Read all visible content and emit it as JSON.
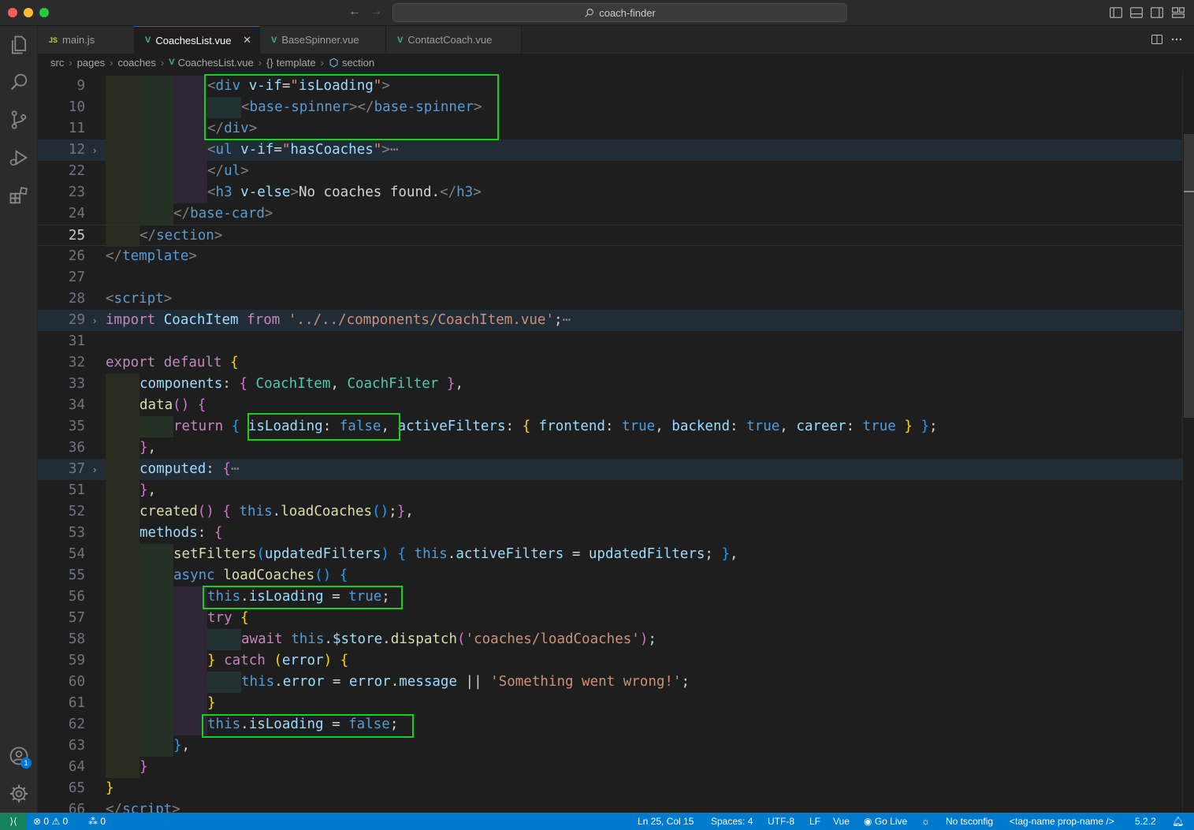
{
  "window": {
    "title": "coach-finder"
  },
  "tabs": [
    {
      "icon": "JS",
      "label": "main.js",
      "active": false
    },
    {
      "icon": "V",
      "label": "CoachesList.vue",
      "active": true,
      "close": "✕"
    },
    {
      "icon": "V",
      "label": "BaseSpinner.vue",
      "active": false
    },
    {
      "icon": "V",
      "label": "ContactCoach.vue",
      "active": false
    }
  ],
  "breadcrumb": {
    "items": [
      "src",
      "pages",
      "coaches",
      "CoachesList.vue",
      "template",
      "section"
    ],
    "template_icon": "{}",
    "vue_icon": "V"
  },
  "editor": {
    "line_numbers": [
      "9",
      "10",
      "11",
      "12",
      "22",
      "23",
      "24",
      "25",
      "26",
      "27",
      "28",
      "29",
      "31",
      "32",
      "33",
      "34",
      "35",
      "36",
      "37",
      "51",
      "52",
      "53",
      "54",
      "55",
      "56",
      "57",
      "58",
      "59",
      "60",
      "61",
      "62",
      "63",
      "64",
      "65",
      "66"
    ],
    "current_line": "25",
    "lines": [
      [
        [
          "t-br",
          "<"
        ],
        [
          "t-tag",
          "div"
        ],
        [
          "t-txt",
          " "
        ],
        [
          "t-attr",
          "v-if"
        ],
        [
          "t-txt",
          "="
        ],
        [
          "t-strq",
          "\""
        ],
        [
          "t-attr",
          "isLoading"
        ],
        [
          "t-strq",
          "\""
        ],
        [
          "t-br",
          ">"
        ]
      ],
      [
        [
          "t-br",
          "<"
        ],
        [
          "t-tag",
          "base-spinner"
        ],
        [
          "t-br",
          "></"
        ],
        [
          "t-tag",
          "base-spinner"
        ],
        [
          "t-br",
          ">"
        ]
      ],
      [
        [
          "t-br",
          "</"
        ],
        [
          "t-tag",
          "div"
        ],
        [
          "t-br",
          ">"
        ]
      ],
      [
        [
          "t-br",
          "<"
        ],
        [
          "t-tag",
          "ul"
        ],
        [
          "t-txt",
          " "
        ],
        [
          "t-attr",
          "v-if"
        ],
        [
          "t-txt",
          "="
        ],
        [
          "t-strq",
          "\""
        ],
        [
          "t-attr",
          "hasCoaches"
        ],
        [
          "t-strq",
          "\""
        ],
        [
          "t-br",
          ">"
        ],
        [
          "t-ell",
          "⋯"
        ]
      ],
      [
        [
          "t-br",
          "</"
        ],
        [
          "t-tag",
          "ul"
        ],
        [
          "t-br",
          ">"
        ]
      ],
      [
        [
          "t-br",
          "<"
        ],
        [
          "t-tag",
          "h3"
        ],
        [
          "t-txt",
          " "
        ],
        [
          "t-attr",
          "v-else"
        ],
        [
          "t-br",
          ">"
        ],
        [
          "t-txt",
          "No coaches found."
        ],
        [
          "t-br",
          "</"
        ],
        [
          "t-tag",
          "h3"
        ],
        [
          "t-br",
          ">"
        ]
      ],
      [
        [
          "t-br",
          "</"
        ],
        [
          "t-tag",
          "base-card"
        ],
        [
          "t-br",
          ">"
        ]
      ],
      [
        [
          "t-br",
          "</"
        ],
        [
          "t-tag",
          "section"
        ],
        [
          "t-br",
          ">"
        ]
      ],
      [
        [
          "t-br",
          "</"
        ],
        [
          "t-tag",
          "template"
        ],
        [
          "t-br",
          ">"
        ]
      ],
      [],
      [
        [
          "t-br",
          "<"
        ],
        [
          "t-tag",
          "script"
        ],
        [
          "t-br",
          ">"
        ]
      ],
      [
        [
          "t-kw",
          "import"
        ],
        [
          "t-txt",
          " "
        ],
        [
          "t-prop",
          "CoachItem"
        ],
        [
          "t-txt",
          " "
        ],
        [
          "t-kw",
          "from"
        ],
        [
          "t-txt",
          " "
        ],
        [
          "t-str",
          "'../../components/CoachItem.vue'"
        ],
        [
          "t-txt",
          ";"
        ],
        [
          "t-ell",
          "⋯"
        ]
      ],
      [],
      [
        [
          "t-kw",
          "export"
        ],
        [
          "t-txt",
          " "
        ],
        [
          "t-kw",
          "default"
        ],
        [
          "t-txt",
          " "
        ],
        [
          "t-b1",
          "{"
        ]
      ],
      [
        [
          "t-prop",
          "components"
        ],
        [
          "t-txt",
          ": "
        ],
        [
          "t-b2",
          "{"
        ],
        [
          "t-txt",
          " "
        ],
        [
          "t-cls",
          "CoachItem"
        ],
        [
          "t-txt",
          ", "
        ],
        [
          "t-cls",
          "CoachFilter"
        ],
        [
          "t-txt",
          " "
        ],
        [
          "t-b2",
          "}"
        ],
        [
          "t-txt",
          ","
        ]
      ],
      [
        [
          "t-fn",
          "data"
        ],
        [
          "t-b2",
          "()"
        ],
        [
          "t-txt",
          " "
        ],
        [
          "t-b2",
          "{"
        ]
      ],
      [
        [
          "t-kw",
          "return"
        ],
        [
          "t-txt",
          " "
        ],
        [
          "t-b3",
          "{"
        ],
        [
          "t-txt",
          " "
        ],
        [
          "t-prop",
          "isLoading"
        ],
        [
          "t-txt",
          ": "
        ],
        [
          "t-kw2",
          "false"
        ],
        [
          "t-txt",
          ", "
        ],
        [
          "t-prop",
          "activeFilters"
        ],
        [
          "t-txt",
          ": "
        ],
        [
          "t-b1",
          "{"
        ],
        [
          "t-txt",
          " "
        ],
        [
          "t-prop",
          "frontend"
        ],
        [
          "t-txt",
          ": "
        ],
        [
          "t-kw2",
          "true"
        ],
        [
          "t-txt",
          ", "
        ],
        [
          "t-prop",
          "backend"
        ],
        [
          "t-txt",
          ": "
        ],
        [
          "t-kw2",
          "true"
        ],
        [
          "t-txt",
          ", "
        ],
        [
          "t-prop",
          "career"
        ],
        [
          "t-txt",
          ": "
        ],
        [
          "t-kw2",
          "true"
        ],
        [
          "t-txt",
          " "
        ],
        [
          "t-b1",
          "}"
        ],
        [
          "t-txt",
          " "
        ],
        [
          "t-b3",
          "}"
        ],
        [
          "t-txt",
          ";"
        ]
      ],
      [
        [
          "t-b2",
          "}"
        ],
        [
          "t-txt",
          ","
        ]
      ],
      [
        [
          "t-prop",
          "computed"
        ],
        [
          "t-txt",
          ": "
        ],
        [
          "t-b2",
          "{"
        ],
        [
          "t-ell",
          "⋯"
        ]
      ],
      [
        [
          "t-b2",
          "}"
        ],
        [
          "t-txt",
          ","
        ]
      ],
      [
        [
          "t-fn",
          "created"
        ],
        [
          "t-b2",
          "()"
        ],
        [
          "t-txt",
          " "
        ],
        [
          "t-b2",
          "{"
        ],
        [
          "t-txt",
          " "
        ],
        [
          "t-kw2",
          "this"
        ],
        [
          "t-txt",
          "."
        ],
        [
          "t-fn",
          "loadCoaches"
        ],
        [
          "t-b3",
          "()"
        ],
        [
          "t-txt",
          ";"
        ],
        [
          "t-b2",
          "}"
        ],
        [
          "t-txt",
          ","
        ]
      ],
      [
        [
          "t-prop",
          "methods"
        ],
        [
          "t-txt",
          ": "
        ],
        [
          "t-b2",
          "{"
        ]
      ],
      [
        [
          "t-fn",
          "setFilters"
        ],
        [
          "t-b3",
          "("
        ],
        [
          "t-prop",
          "updatedFilters"
        ],
        [
          "t-b3",
          ")"
        ],
        [
          "t-txt",
          " "
        ],
        [
          "t-b3",
          "{"
        ],
        [
          "t-txt",
          " "
        ],
        [
          "t-kw2",
          "this"
        ],
        [
          "t-txt",
          "."
        ],
        [
          "t-prop",
          "activeFilters"
        ],
        [
          "t-txt",
          " = "
        ],
        [
          "t-prop",
          "updatedFilters"
        ],
        [
          "t-txt",
          "; "
        ],
        [
          "t-b3",
          "}"
        ],
        [
          "t-txt",
          ","
        ]
      ],
      [
        [
          "t-kw2",
          "async"
        ],
        [
          "t-txt",
          " "
        ],
        [
          "t-fn",
          "loadCoaches"
        ],
        [
          "t-b3",
          "()"
        ],
        [
          "t-txt",
          " "
        ],
        [
          "t-b3",
          "{"
        ]
      ],
      [
        [
          "t-kw2",
          "this"
        ],
        [
          "t-txt",
          "."
        ],
        [
          "t-prop",
          "isLoading"
        ],
        [
          "t-txt",
          " = "
        ],
        [
          "t-kw2",
          "true"
        ],
        [
          "t-txt",
          ";"
        ]
      ],
      [
        [
          "t-kw",
          "try"
        ],
        [
          "t-txt",
          " "
        ],
        [
          "t-b1",
          "{"
        ]
      ],
      [
        [
          "t-kw",
          "await"
        ],
        [
          "t-txt",
          " "
        ],
        [
          "t-kw2",
          "this"
        ],
        [
          "t-txt",
          "."
        ],
        [
          "t-prop",
          "$store"
        ],
        [
          "t-txt",
          "."
        ],
        [
          "t-fn",
          "dispatch"
        ],
        [
          "t-b2",
          "("
        ],
        [
          "t-str",
          "'coaches/loadCoaches'"
        ],
        [
          "t-b2",
          ")"
        ],
        [
          "t-txt",
          ";"
        ]
      ],
      [
        [
          "t-b1",
          "}"
        ],
        [
          "t-txt",
          " "
        ],
        [
          "t-kw",
          "catch"
        ],
        [
          "t-txt",
          " "
        ],
        [
          "t-b1",
          "("
        ],
        [
          "t-prop",
          "error"
        ],
        [
          "t-b1",
          ")"
        ],
        [
          "t-txt",
          " "
        ],
        [
          "t-b1",
          "{"
        ]
      ],
      [
        [
          "t-kw2",
          "this"
        ],
        [
          "t-txt",
          "."
        ],
        [
          "t-prop",
          "error"
        ],
        [
          "t-txt",
          " = "
        ],
        [
          "t-prop",
          "error"
        ],
        [
          "t-txt",
          "."
        ],
        [
          "t-prop",
          "message"
        ],
        [
          "t-txt",
          " || "
        ],
        [
          "t-str",
          "'Something went wrong!'"
        ],
        [
          "t-txt",
          ";"
        ]
      ],
      [
        [
          "t-b1",
          "}"
        ]
      ],
      [
        [
          "t-kw2",
          "this"
        ],
        [
          "t-txt",
          "."
        ],
        [
          "t-prop",
          "isLoading"
        ],
        [
          "t-txt",
          " = "
        ],
        [
          "t-kw2",
          "false"
        ],
        [
          "t-txt",
          ";"
        ]
      ],
      [
        [
          "t-b3",
          "}"
        ],
        [
          "t-txt",
          ","
        ]
      ],
      [
        [
          "t-b2",
          "}"
        ]
      ],
      [
        [
          "t-b1",
          "}"
        ]
      ],
      [
        [
          "t-br",
          "</"
        ],
        [
          "t-tag",
          "script"
        ],
        [
          "t-br",
          ">"
        ]
      ]
    ]
  },
  "status": {
    "remote_icon": "⟩⟨",
    "errors": "0",
    "warnings": "0",
    "ports": "0",
    "position": "Ln 25, Col 15",
    "spaces": "Spaces: 4",
    "encoding": "UTF-8",
    "eol": "LF",
    "language": "Vue",
    "golive": "Go Live",
    "tsconfig": "No tsconfig",
    "tagname": "<tag-name prop-name />",
    "version": "5.2.2"
  },
  "accounts_badge": "1",
  "colors": {
    "accent": "#0078d4",
    "statusbar": "#007acc",
    "highlight_box": "#17d117"
  }
}
